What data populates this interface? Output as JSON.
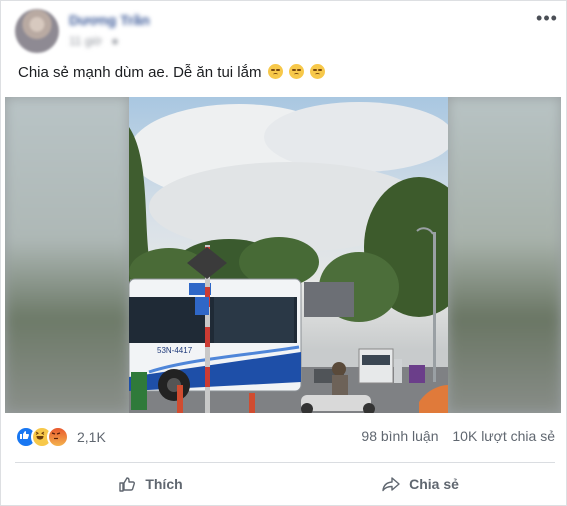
{
  "post": {
    "author_name": "Dương Trần",
    "time": "11 giờ",
    "caption": "Chia sẻ mạnh dùm ae. Dễ ăn tui lắm",
    "caption_emoji_count": 3
  },
  "video": {
    "bus_plate": "53N-4417"
  },
  "stats": {
    "reactions": [
      "like",
      "haha",
      "angry"
    ],
    "reaction_count": "2,1K",
    "comments": "98 bình luận",
    "shares": "10K lượt chia sẻ"
  },
  "actions": {
    "like_label": "Thích",
    "share_label": "Chia sẻ"
  },
  "colors": {
    "like_blue": "#1877f2",
    "author_blue": "#3b5998",
    "muted_text": "#606770"
  }
}
